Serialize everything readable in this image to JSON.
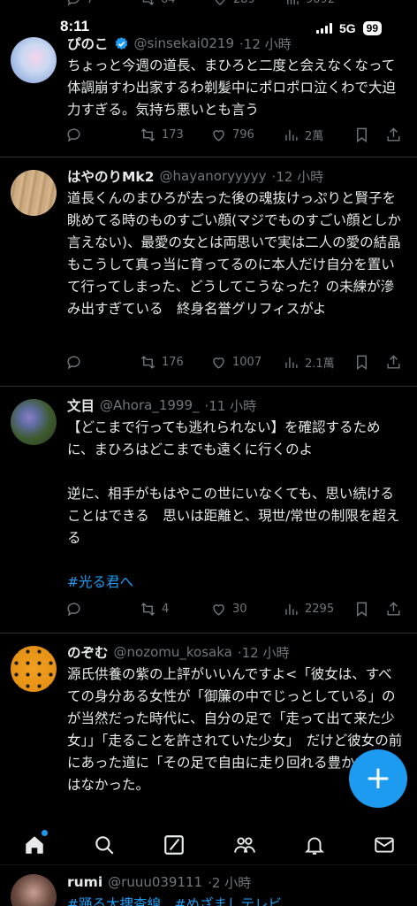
{
  "status_bar": {
    "time": "8:11",
    "network": "5G",
    "battery": "99"
  },
  "prev_tweet_actions": {
    "retweets": "64",
    "likes": "289",
    "views": "9092"
  },
  "tweets": [
    {
      "name": "ぴのこ",
      "handle": "@sinsekai0219",
      "time": "·12 小時",
      "verified": true,
      "text": "ちょっと今週の道長、まひろと二度と会えなくなって体調崩すわ出家するわ剃髪中にポロポロ泣くわで大迫力すぎる。気持ち悪いとも言う",
      "retweets": "173",
      "likes": "796",
      "views": "2萬"
    },
    {
      "name": "はやのりMk2",
      "handle": "@hayanoryyyyy",
      "time": "·12 小時",
      "verified": false,
      "text": "道長くんのまひろが去った後の魂抜けっぷりと賢子を眺めてる時のものすごい顔(マジでものすごい顔としか言えない)、最愛の女とは両思いで実は二人の愛の結晶もこうして真っ当に育ってるのに本人だけ自分を置いて行ってしまった、どうしてこうなった？の未練が滲み出すぎている　終身名誉グリフィスがよ",
      "retweets": "176",
      "likes": "1007",
      "views": "2.1萬"
    },
    {
      "name": "文目",
      "handle": "@Ahora_1999_",
      "time": "·11 小時",
      "verified": false,
      "text": "【どこまで行っても逃れられない】を確認するために、まひろはどこまでも遠くに行くのよ\n\n逆に、相手がもはやこの世にいなくても、思い続けることはできる　思いは距離と、現世/常世の制限を超える",
      "hashtag": "#光る君へ",
      "retweets": "4",
      "likes": "30",
      "views": "2295"
    },
    {
      "name": "のぞむ",
      "handle": "@nozomu_kosaka",
      "time": "·12 小時",
      "verified": false,
      "text": "源氏供養の紫の上評がいいんですよ<「彼女は、すべての身分ある女性が「御簾の中でじっとしている」のが当然だった時代に、自分の足で「走って出て来た少女」」「走ることを許されていた少女」　だけど彼女の前にあった道に「その足で自由に走り回れる豊かな空間」はなかった。"
    },
    {
      "name": "rumi",
      "handle": "@ruuu039111",
      "time": "·2 小時",
      "verified": false,
      "text": "#踊る大捜査線　#めざましテレビ"
    }
  ],
  "icons": {
    "reply": "reply-icon",
    "retweet": "retweet-icon",
    "like": "like-icon",
    "views": "views-icon",
    "bookmark": "bookmark-icon",
    "share": "share-icon",
    "verified": "verified-badge-icon",
    "compose": "compose-plus-icon"
  },
  "colors": {
    "accent": "#1d9bf0",
    "muted": "#71767b",
    "text": "#e7e9ea",
    "divider": "#2f3336"
  },
  "fab": {
    "label": "+"
  }
}
